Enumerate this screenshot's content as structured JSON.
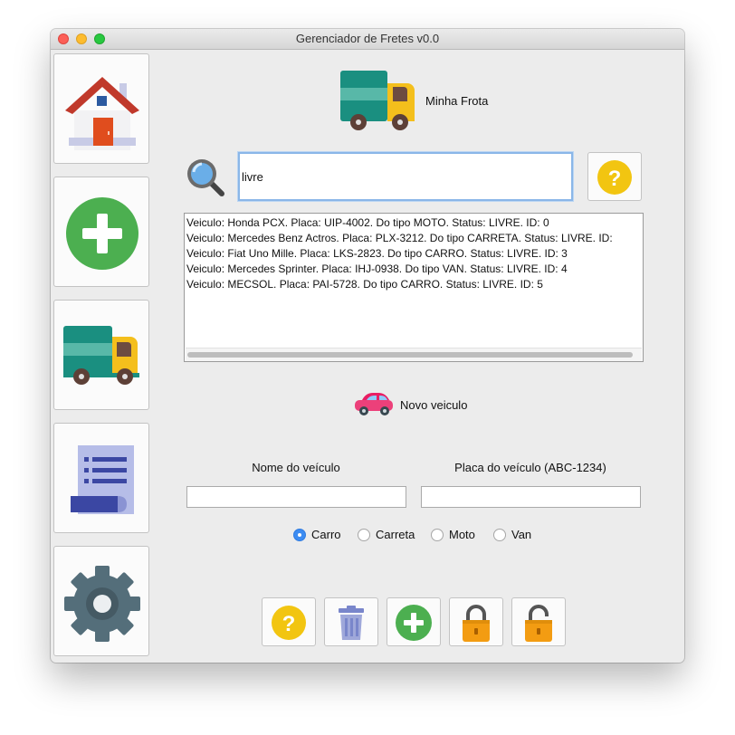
{
  "window": {
    "title": "Gerenciador de Fretes v0.0"
  },
  "sidebar": {
    "items": [
      {
        "name": "home",
        "icon": "house-icon"
      },
      {
        "name": "add",
        "icon": "plus-circle-icon"
      },
      {
        "name": "fleet",
        "icon": "truck-icon"
      },
      {
        "name": "reports",
        "icon": "document-icon"
      },
      {
        "name": "settings",
        "icon": "gear-icon"
      }
    ]
  },
  "header": {
    "label": "Minha Frota",
    "icon": "truck-icon"
  },
  "search": {
    "value": "livre",
    "icon": "magnifier-icon",
    "help_icon": "help-icon"
  },
  "results": {
    "rows": [
      "Veiculo: Honda PCX. Placa: UIP-4002. Do tipo MOTO. Status: LIVRE. ID: 0",
      "Veiculo: Mercedes Benz Actros. Placa: PLX-3212. Do tipo CARRETA. Status: LIVRE. ID:",
      "Veiculo: Fiat Uno Mille. Placa: LKS-2823. Do tipo CARRO. Status: LIVRE. ID: 3",
      "Veiculo: Mercedes Sprinter. Placa: IHJ-0938. Do tipo VAN. Status: LIVRE. ID: 4",
      "Veiculo: MECSOL. Placa: PAI-5728. Do tipo CARRO. Status: LIVRE. ID: 5"
    ]
  },
  "new_vehicle": {
    "label": "Novo veiculo",
    "icon": "car-icon",
    "name_label": "Nome do veículo",
    "name_value": "",
    "plate_label": "Placa do veículo (ABC-1234)",
    "plate_value": "",
    "types": [
      "Carro",
      "Carreta",
      "Moto",
      "Van"
    ],
    "selected_type": "Carro"
  },
  "toolbar": {
    "buttons": [
      {
        "name": "help",
        "icon": "help-icon"
      },
      {
        "name": "delete",
        "icon": "trash-icon"
      },
      {
        "name": "add",
        "icon": "plus-circle-icon"
      },
      {
        "name": "lock",
        "icon": "lock-closed-icon"
      },
      {
        "name": "unlock",
        "icon": "lock-open-icon"
      }
    ]
  },
  "colors": {
    "accent_blue": "#3c8cf2",
    "truck_teal": "#1a8f80",
    "truck_yellow": "#f4bf1c",
    "add_green": "#4caf50",
    "help_yellow": "#f2c511",
    "lock_orange": "#f39c12"
  }
}
